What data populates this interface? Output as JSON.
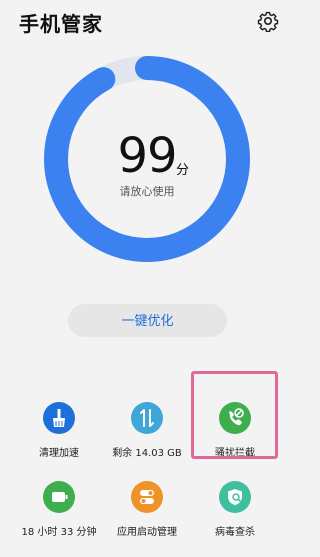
{
  "header": {
    "title": "手机管家",
    "settings_icon": "gear-icon"
  },
  "score": {
    "value": "99",
    "unit": "分",
    "subtitle": "请放心使用",
    "ring_fill_fraction": 0.92,
    "ring_color": "#3b82f0"
  },
  "optimize_button": {
    "label": "一键优化"
  },
  "tools": [
    {
      "label": "清理加速",
      "icon": "broom-icon",
      "color": "#1f6fd8"
    },
    {
      "label": "剩余 14.03 GB",
      "icon": "storage-arrows-icon",
      "color": "#3fa6d8"
    },
    {
      "label": "骚扰拦截",
      "icon": "phone-block-icon",
      "color": "#3fae4f"
    },
    {
      "label": "18 小时 33 分钟",
      "icon": "battery-icon",
      "color": "#3fae4f"
    },
    {
      "label": "应用启动管理",
      "icon": "toggle-icon",
      "color": "#f0922a"
    },
    {
      "label": "病毒查杀",
      "icon": "virus-scan-icon",
      "color": "#3fbfa0"
    }
  ]
}
